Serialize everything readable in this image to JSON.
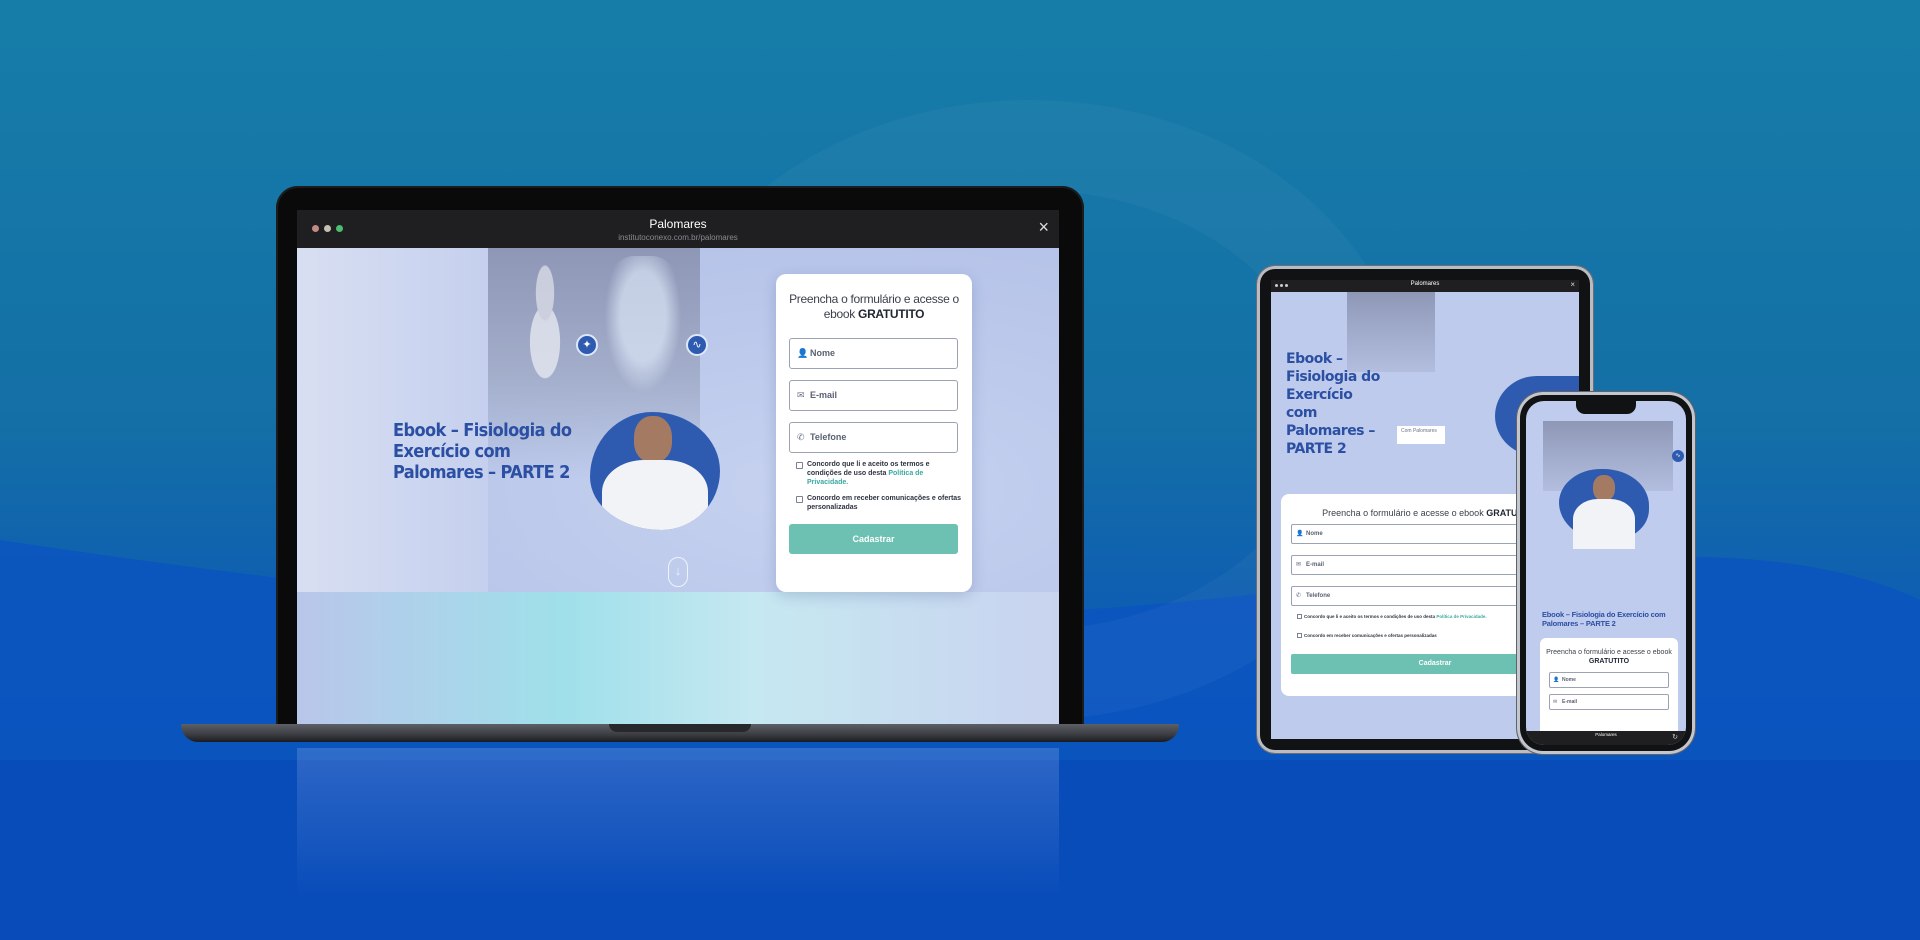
{
  "colors": {
    "bg_top": "#167da8",
    "bg_bottom": "#0747b4",
    "brand_blue": "#2b4fa3",
    "button_teal": "#6cc1b2",
    "link_teal": "#3aa8a0",
    "dot_red": "#c28b83",
    "dot_yellow": "#c4c1b3",
    "dot_green": "#4cbe6f"
  },
  "laptop": {
    "window": {
      "title": "Palomares",
      "url": "institutoconexo.com.br/palomares",
      "close_icon": "×"
    },
    "page": {
      "ebook_title": "Ebook – Fisiologia do Exercício com Palomares – PARTE 2",
      "scroll_icon": "↓"
    },
    "form": {
      "title_prefix": "Preencha o formulário e acesse o ebook",
      "title_bold": "GRATUTITO",
      "fields": {
        "name_placeholder": "Nome",
        "email_placeholder": "E-mail",
        "phone_placeholder": "Telefone"
      },
      "consent_terms_prefix": "Concordo que li e aceito os termos e condições de uso desta",
      "consent_terms_link": "Política de Privacidade.",
      "consent_marketing": "Concordo em receber comunicações e ofertas personalizadas",
      "submit_label": "Cadastrar"
    }
  },
  "tablet": {
    "window_title": "Palomares",
    "ebook_title": "Ebook – Fisiologia do Exercício com Palomares – PARTE 2",
    "tooltip": "Com Palomares",
    "form": {
      "title_prefix": "Preencha o formulário e acesse o ebook",
      "title_bold": "GRATUTITO",
      "name_placeholder": "Nome",
      "email_placeholder": "E-mail",
      "phone_placeholder": "Telefone",
      "consent_terms_prefix": "Concordo que li e aceito os termos e condições de uso desta",
      "consent_terms_link": "Política de Privacidade.",
      "consent_marketing": "Concordo em receber comunicações e ofertas personalizadas",
      "submit_label": "Cadastrar"
    }
  },
  "phone": {
    "ebook_title": "Ebook – Fisiologia do Exercício com Palomares – PARTE 2",
    "form": {
      "title_prefix": "Preencha o formulário e acesse o ebook",
      "title_bold": "GRATUTITO",
      "name_placeholder": "Nome",
      "email_placeholder": "E-mail"
    },
    "bottom_bar_title": "Palomares"
  }
}
